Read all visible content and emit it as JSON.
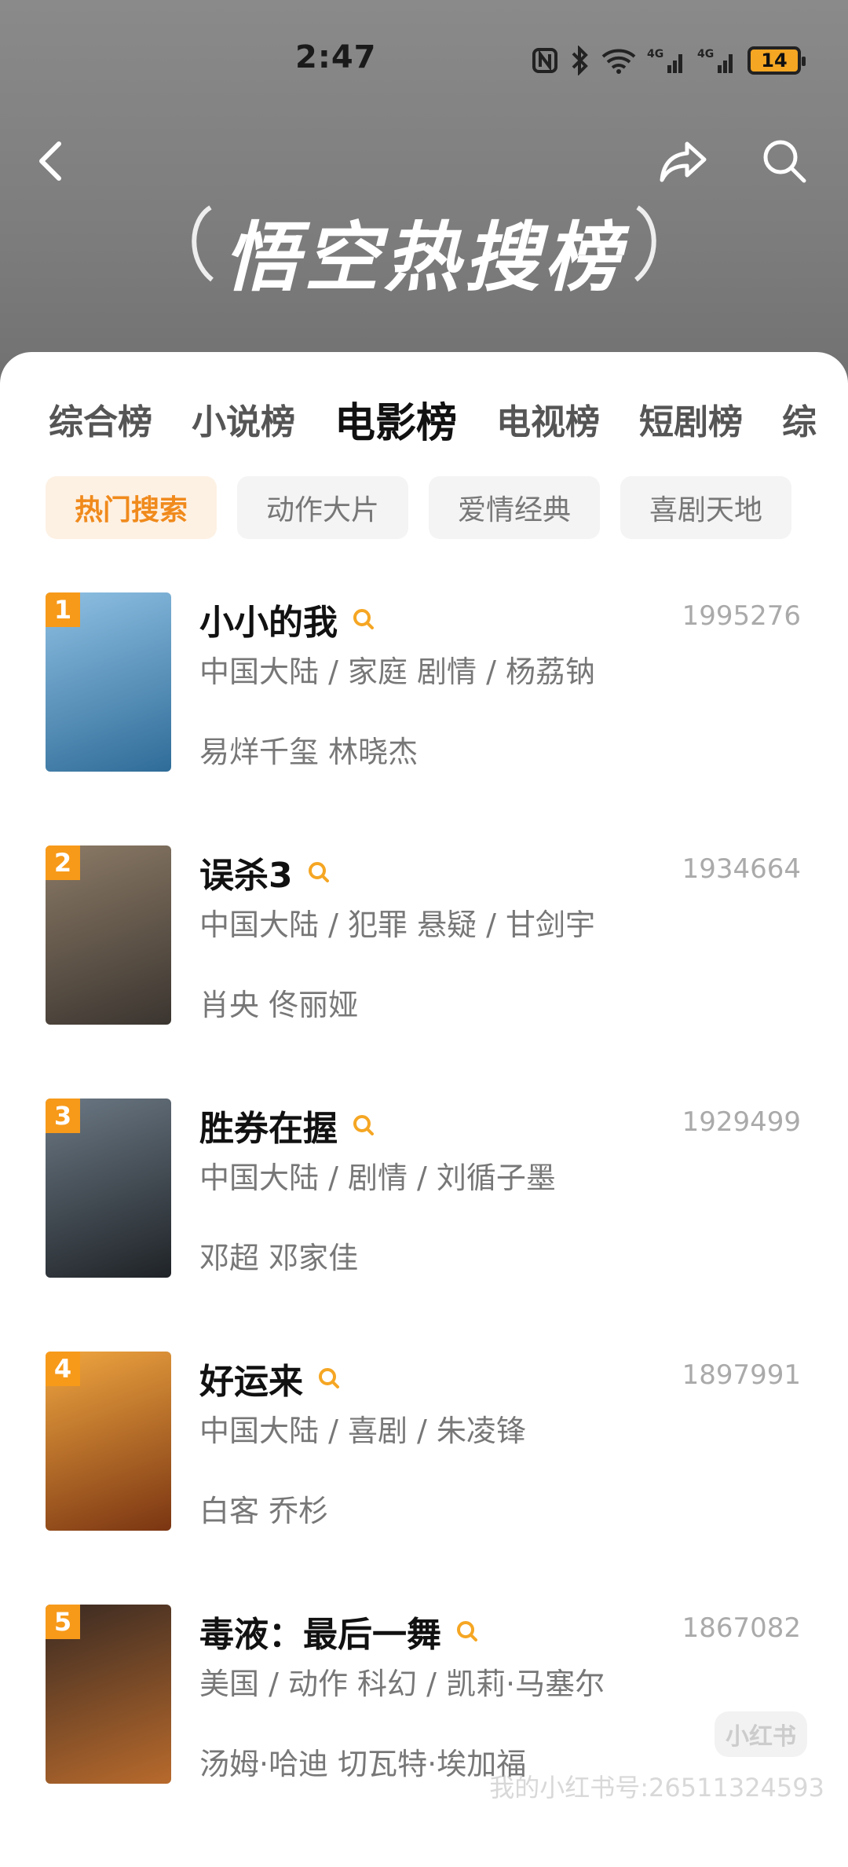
{
  "status": {
    "time": "2:47",
    "battery": "14"
  },
  "header": {
    "title": "悟空热搜榜"
  },
  "tabs": [
    {
      "label": "综合榜"
    },
    {
      "label": "小说榜"
    },
    {
      "label": "电影榜",
      "active": true
    },
    {
      "label": "电视榜"
    },
    {
      "label": "短剧榜"
    },
    {
      "label": "综"
    }
  ],
  "chips": [
    {
      "label": "热门搜索",
      "active": true
    },
    {
      "label": "动作大片"
    },
    {
      "label": "爱情经典"
    },
    {
      "label": "喜剧天地"
    }
  ],
  "movies": [
    {
      "rank": "1",
      "title": "小小的我",
      "score": "1995276",
      "meta": "中国大陆 / 家庭 剧情 / 杨荔钠",
      "cast": "易烊千玺 林晓杰",
      "poster_colors": [
        "#6da2c9",
        "#2f6c98"
      ]
    },
    {
      "rank": "2",
      "title": "误杀3",
      "score": "1934664",
      "meta": "中国大陆 / 犯罪 悬疑 / 甘剑宇",
      "cast": "肖央 佟丽娅",
      "poster_colors": [
        "#8b7a66",
        "#3b3530"
      ]
    },
    {
      "rank": "3",
      "title": "胜券在握",
      "score": "1929499",
      "meta": "中国大陆 / 剧情 / 刘循子墨",
      "cast": "邓超 邓家佳",
      "poster_colors": [
        "#4c5963",
        "#1f2327"
      ]
    },
    {
      "rank": "4",
      "title": "好运来",
      "score": "1897991",
      "meta": "中国大陆 / 喜剧 / 朱凌锋",
      "cast": "白客 乔杉",
      "poster_colors": [
        "#e0892a",
        "#7a3512"
      ]
    },
    {
      "rank": "5",
      "title": "毒液：最后一舞",
      "score": "1867082",
      "meta": "美国 / 动作 科幻 / 凯莉·马塞尔",
      "cast": "汤姆·哈迪  切瓦特·埃加福",
      "poster_colors": [
        "#b86a2c",
        "#1b1410"
      ]
    }
  ],
  "watermark": {
    "logo": "小红书",
    "text": "我的小红书号:26511324593"
  }
}
